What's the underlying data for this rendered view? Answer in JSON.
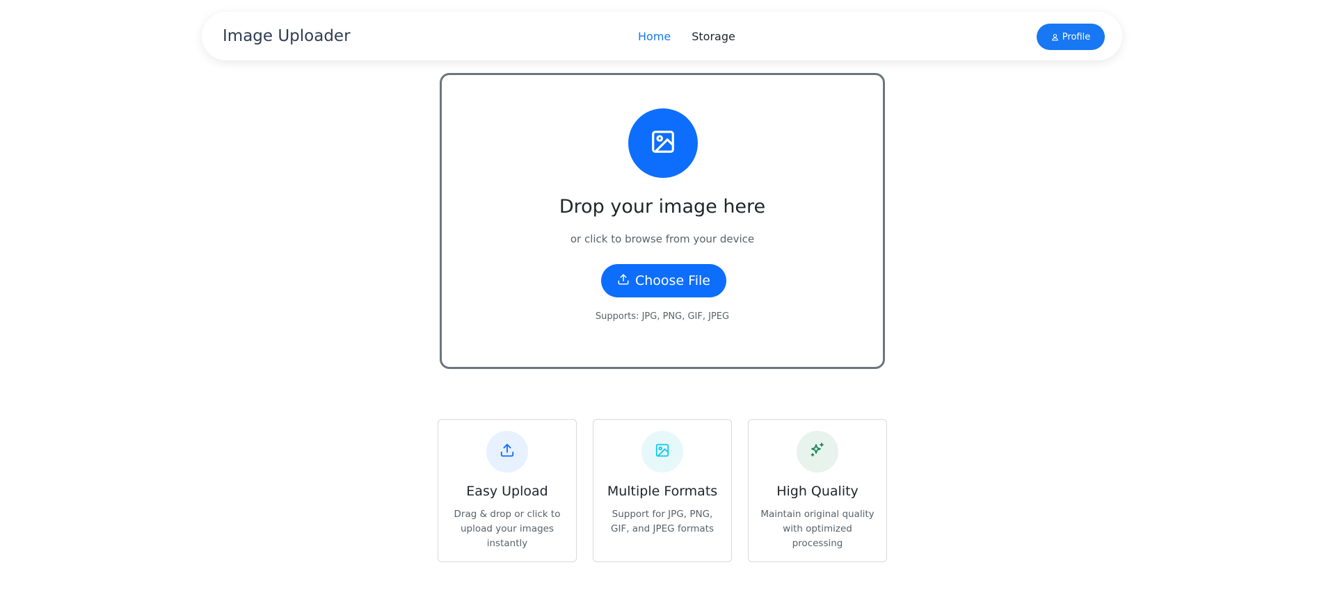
{
  "navbar": {
    "brand": "Image Uploader",
    "links": [
      {
        "label": "Home",
        "active": true
      },
      {
        "label": "Storage",
        "active": false
      }
    ],
    "profile_button": {
      "label": "Profile",
      "icon": "user-icon"
    }
  },
  "dropzone": {
    "icon": "image-icon",
    "title": "Drop your image here",
    "subtitle": "or click to browse from your device",
    "button": {
      "label": "Choose File",
      "icon": "upload-icon"
    },
    "supports": "Supports: JPG, PNG, GIF, JPEG"
  },
  "features": [
    {
      "icon": "upload-icon",
      "title": "Easy Upload",
      "description": "Drag & drop or click to upload your images instantly",
      "icon_color": "#0d6efd",
      "icon_bg": "#e7f1ff"
    },
    {
      "icon": "image-icon",
      "title": "Multiple Formats",
      "description": "Support for JPG, PNG, GIF, and JPEG formats",
      "icon_color": "#0dcaf0",
      "icon_bg": "#e7f8fb"
    },
    {
      "icon": "sparkles-icon",
      "title": "High Quality",
      "description": "Maintain original quality with optimized processing",
      "icon_color": "#198754",
      "icon_bg": "#e8f3ee"
    }
  ],
  "colors": {
    "primary": "#0d6efd",
    "nav_active": "#1877f2",
    "dropzone_border": "#6c757d"
  }
}
